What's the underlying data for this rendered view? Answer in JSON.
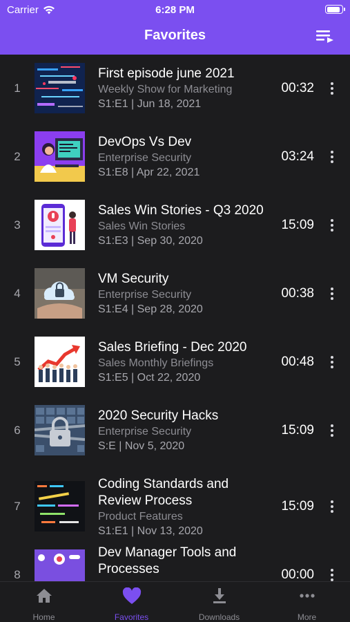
{
  "status_bar": {
    "carrier": "Carrier",
    "time": "6:28 PM",
    "battery_level": 0.9
  },
  "nav": {
    "title": "Favorites",
    "queue_icon": "playlist-icon"
  },
  "colors": {
    "accent": "#7b4ff0",
    "background": "#1c1c1e",
    "secondary_text": "#8d8d93"
  },
  "episodes": [
    {
      "index": "1",
      "title_lines": [
        "First episode june 2021"
      ],
      "show": "Weekly Show for Marketing",
      "meta": "S1:E1 | Jun 18, 2021",
      "duration": "00:32",
      "thumb_icon": "network-thumbnail"
    },
    {
      "index": "2",
      "title_lines": [
        "DevOps Vs Dev"
      ],
      "show": "Enterprise Security",
      "meta": "S1:E8 | Apr 22, 2021",
      "duration": "03:24",
      "thumb_icon": "developer-thumbnail"
    },
    {
      "index": "3",
      "title_lines": [
        "Sales Win Stories - Q3 2020"
      ],
      "show": "Sales Win Stories",
      "meta": "S1:E3 | Sep 30, 2020",
      "duration": "15:09",
      "thumb_icon": "podcast-phone-thumbnail"
    },
    {
      "index": "4",
      "title_lines": [
        "VM Security"
      ],
      "show": "Enterprise Security",
      "meta": "S1:E4 | Sep 28, 2020",
      "duration": "00:38",
      "thumb_icon": "cloud-lock-thumbnail"
    },
    {
      "index": "5",
      "title_lines": [
        "Sales Briefing - Dec 2020"
      ],
      "show": "Sales Monthly Briefings",
      "meta": "S1:E5 | Oct 22, 2020",
      "duration": "00:48",
      "thumb_icon": "growth-team-thumbnail"
    },
    {
      "index": "6",
      "title_lines": [
        "2020 Security Hacks"
      ],
      "show": "Enterprise Security",
      "meta": "S:E | Nov 5, 2020",
      "duration": "15:09",
      "thumb_icon": "padlock-keyboard-thumbnail"
    },
    {
      "index": "7",
      "title_lines": [
        "Coding Standards and",
        "Review Process"
      ],
      "show": "Product Features",
      "meta": "S1:E1 | Nov 13, 2020",
      "duration": "15:09",
      "thumb_icon": "code-thumbnail"
    },
    {
      "index": "8",
      "title_lines": [
        "Dev Manager Tools and",
        "Processes"
      ],
      "show": "",
      "meta": "",
      "duration": "00:00",
      "thumb_icon": "tools-thumbnail"
    }
  ],
  "tabs": [
    {
      "label": "Home",
      "icon": "home-icon",
      "active": false
    },
    {
      "label": "Favorites",
      "icon": "heart-icon",
      "active": true
    },
    {
      "label": "Downloads",
      "icon": "download-icon",
      "active": false
    },
    {
      "label": "More",
      "icon": "more-horizontal-icon",
      "active": false
    }
  ]
}
